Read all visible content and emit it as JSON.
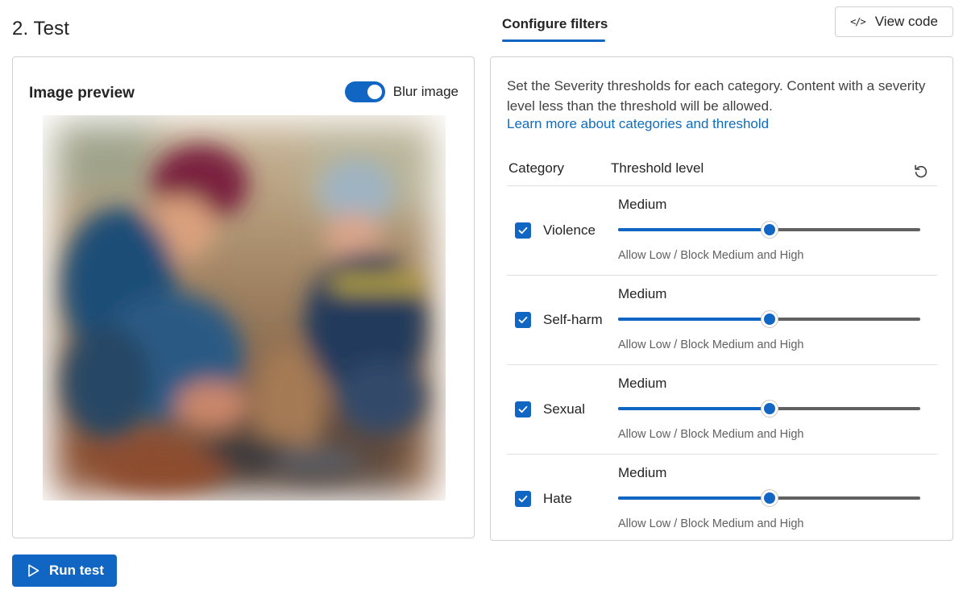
{
  "section": {
    "title": "2. Test"
  },
  "preview": {
    "label": "Image preview",
    "blur_toggle": {
      "label": "Blur image",
      "on": true
    }
  },
  "tabs": {
    "configure_filters": "Configure filters"
  },
  "view_code": {
    "label": "View code",
    "icon": "code-icon"
  },
  "filters": {
    "description": "Set the Severity thresholds for each category. Content with a severity level less than the threshold will be allowed.",
    "learn_more": "Learn more about categories and threshold",
    "columns": {
      "category": "Category",
      "threshold": "Threshold level"
    },
    "reset_icon": "undo-icon",
    "rows": [
      {
        "category": "Violence",
        "checked": true,
        "level": "Medium",
        "slider_value": 0.5,
        "hint": "Allow Low / Block Medium and High"
      },
      {
        "category": "Self-harm",
        "checked": true,
        "level": "Medium",
        "slider_value": 0.5,
        "hint": "Allow Low / Block Medium and High"
      },
      {
        "category": "Sexual",
        "checked": true,
        "level": "Medium",
        "slider_value": 0.5,
        "hint": "Allow Low / Block Medium and High"
      },
      {
        "category": "Hate",
        "checked": true,
        "level": "Medium",
        "slider_value": 0.5,
        "hint": "Allow Low / Block Medium and High"
      }
    ]
  },
  "run_test": {
    "label": "Run test",
    "icon": "play-icon"
  },
  "colors": {
    "accent": "#1166c3",
    "link": "#0f6cbd",
    "border": "#d1d1d1",
    "rail": "#616161"
  }
}
